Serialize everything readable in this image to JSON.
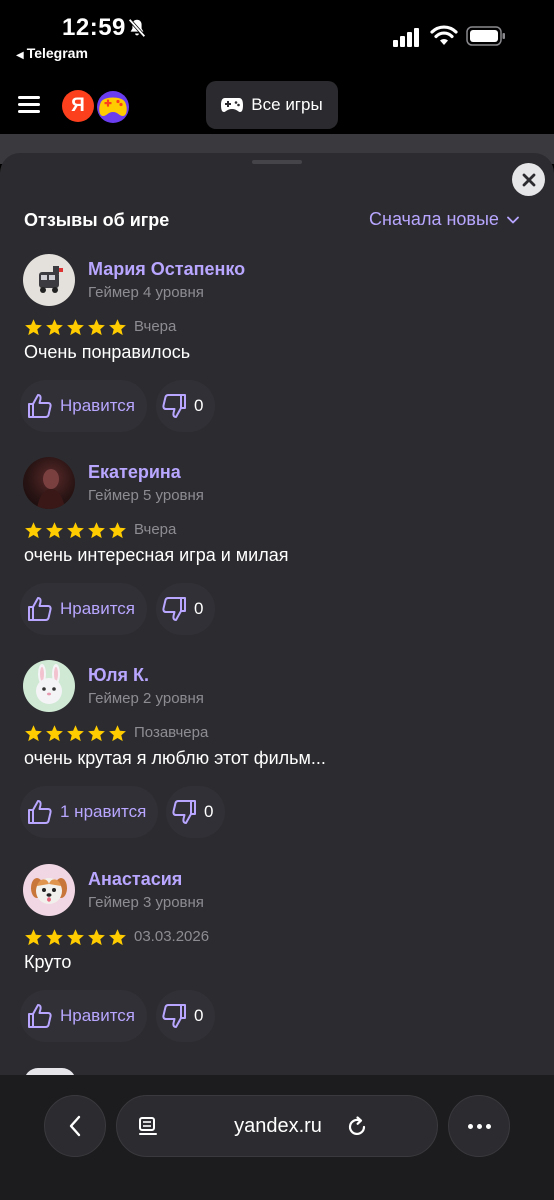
{
  "status_bar": {
    "time": "12:59",
    "back_app": "Telegram"
  },
  "header": {
    "logo_letter": "Я",
    "all_games_label": "Все игры"
  },
  "reviews": {
    "title": "Отзывы об игре",
    "sort_label": "Сначала новые",
    "items": [
      {
        "name": "Мария Остапенко",
        "level": "Геймер 4 уровня",
        "rating": 5,
        "date": "Вчера",
        "text": "Очень понравилось",
        "like_label": "Нравится",
        "dislike_count": "0"
      },
      {
        "name": "Екатерина",
        "level": "Геймер 5 уровня",
        "rating": 5,
        "date": "Вчера",
        "text": "очень интересная игра  и милая",
        "like_label": "Нравится",
        "dislike_count": "0"
      },
      {
        "name": "Юля К.",
        "level": "Геймер 2 уровня",
        "rating": 5,
        "date": "Позавчера",
        "text": "очень крутая я люблю этот фильм...",
        "like_label": "1 нравится",
        "dislike_count": "0"
      },
      {
        "name": "Анастасия",
        "level": "Геймер 3 уровня",
        "rating": 5,
        "date": "03.03.2026",
        "text": "Круто",
        "like_label": "Нравится",
        "dislike_count": "0"
      }
    ]
  },
  "browser": {
    "url": "yandex.ru"
  },
  "colors": {
    "accent": "#b8a6ff",
    "star": "#ffcc00",
    "sheet_bg": "#2c2c30"
  }
}
